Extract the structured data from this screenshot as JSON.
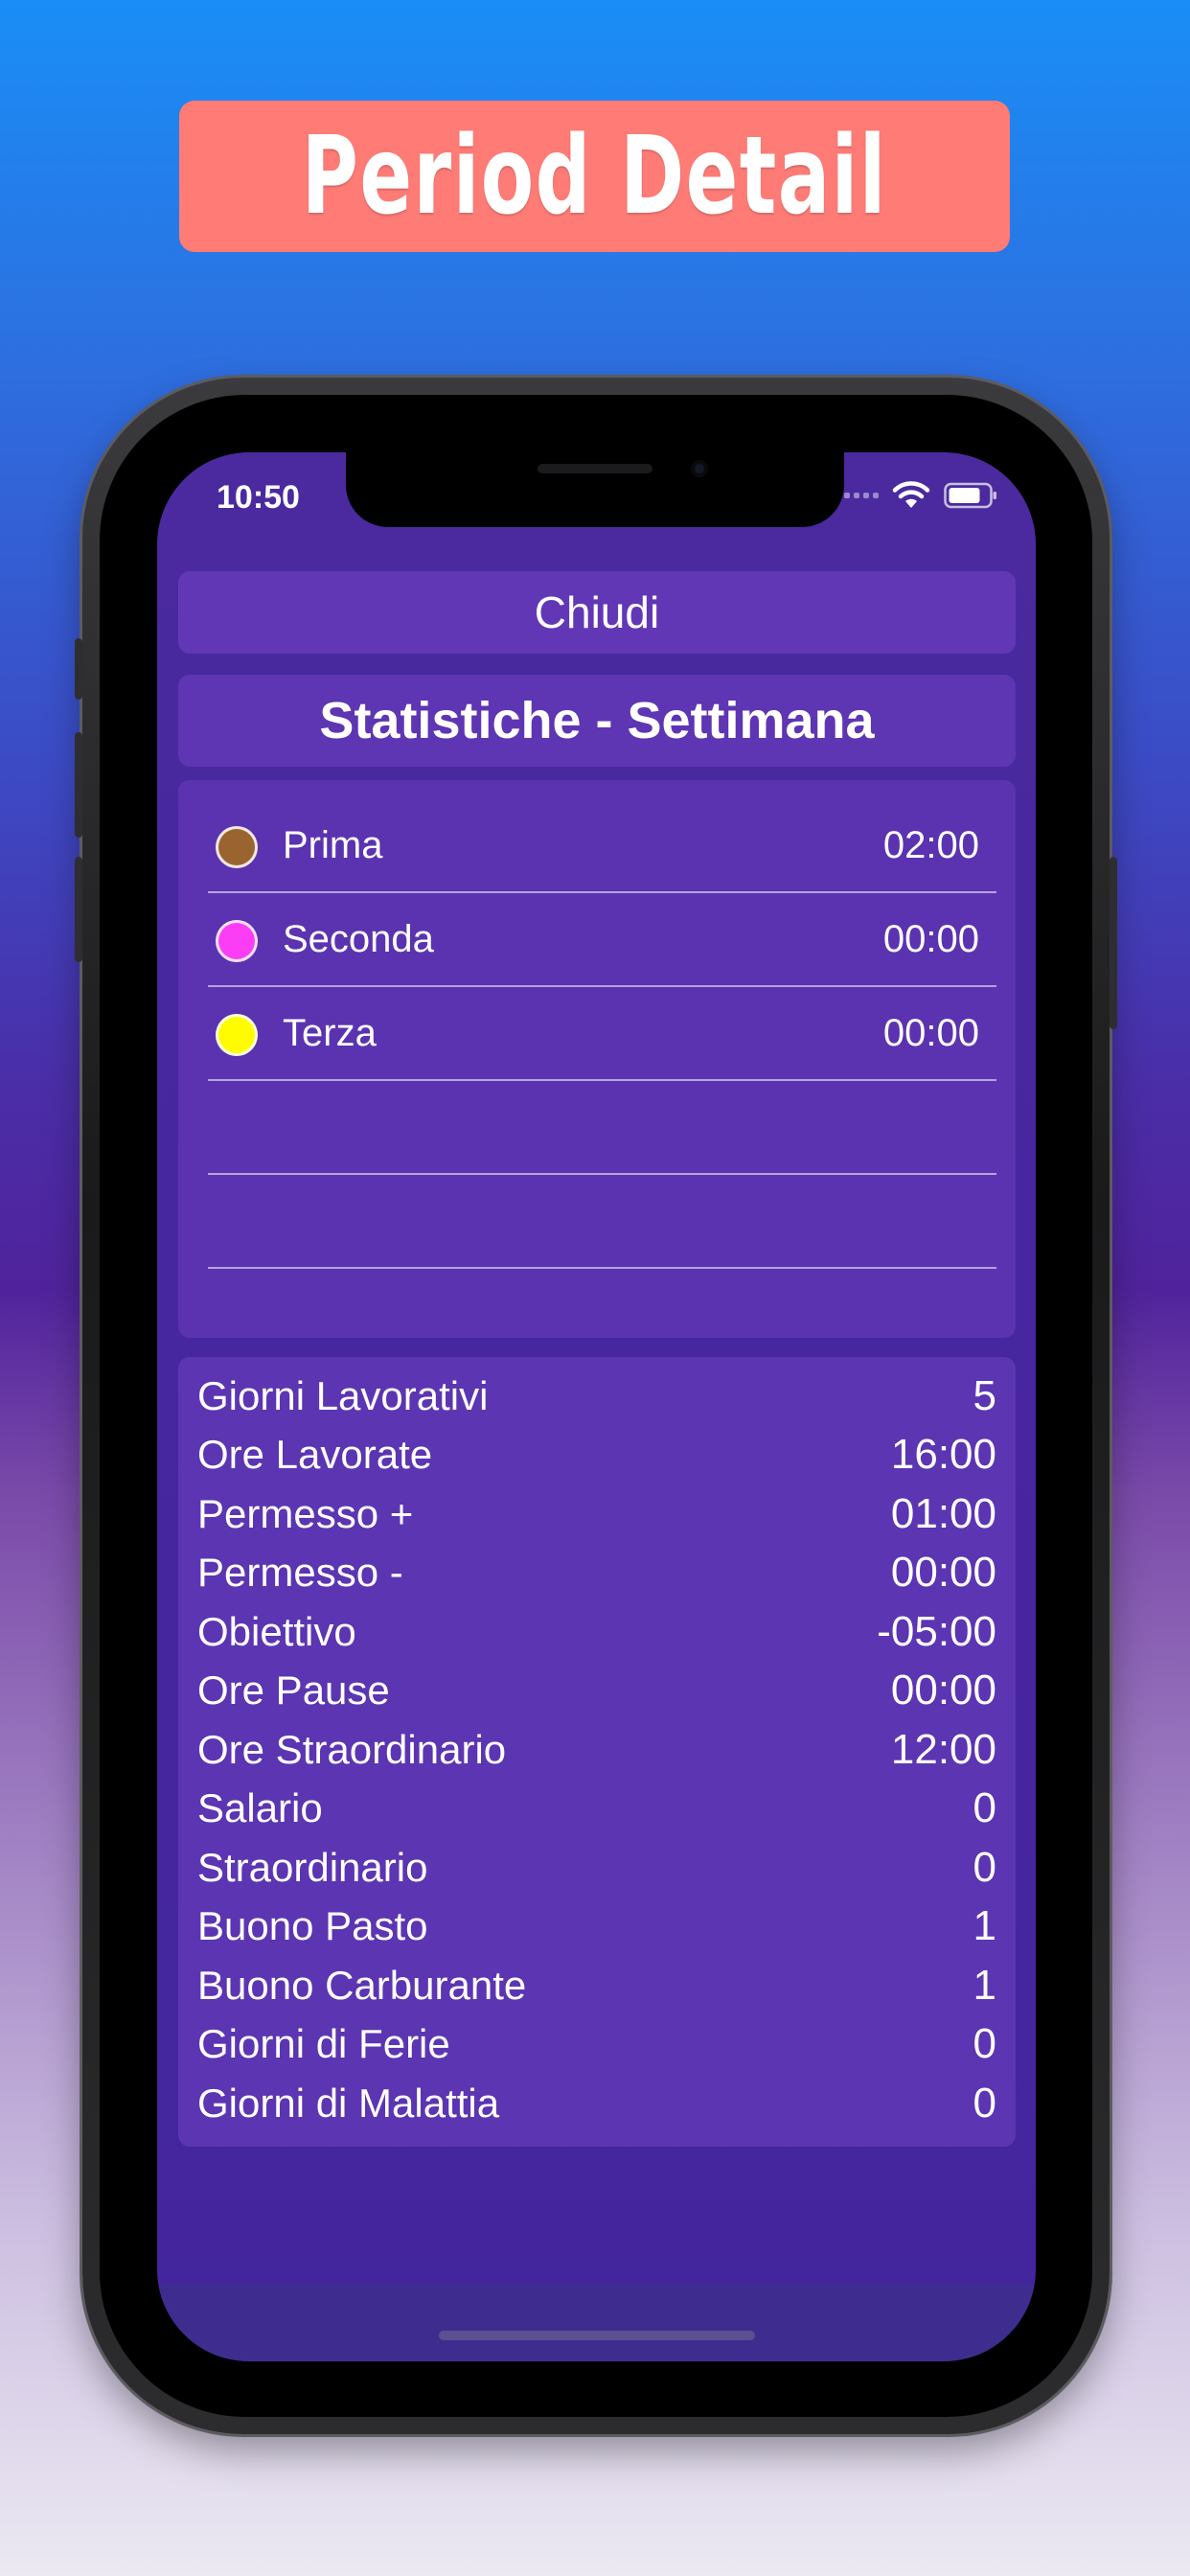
{
  "banner": {
    "title": "Period Detail",
    "color": "#fe7b76"
  },
  "status_bar": {
    "time": "10:50",
    "icons": [
      "signal-icon",
      "wifi-icon",
      "battery-icon"
    ]
  },
  "close_button": {
    "label": "Chiudi"
  },
  "title": "Statistiche - Settimana",
  "legend": {
    "items": [
      {
        "name": "Prima",
        "value": "02:00",
        "color": "#9a6431"
      },
      {
        "name": "Seconda",
        "value": "00:00",
        "color": "#fb3ef5"
      },
      {
        "name": "Terza",
        "value": "00:00",
        "color": "#fffb00"
      }
    ]
  },
  "stats": {
    "rows": [
      {
        "label": "Giorni Lavorativi",
        "value": "5"
      },
      {
        "label": "Ore Lavorate",
        "value": "16:00"
      },
      {
        "label": "Permesso +",
        "value": "01:00"
      },
      {
        "label": "Permesso -",
        "value": "00:00"
      },
      {
        "label": "Obiettivo",
        "value": "-05:00"
      },
      {
        "label": "Ore Pause",
        "value": "00:00"
      },
      {
        "label": "Ore Straordinario",
        "value": "12:00"
      },
      {
        "label": "Salario",
        "value": "0"
      },
      {
        "label": "Straordinario",
        "value": "0"
      },
      {
        "label": "Buono Pasto",
        "value": "1"
      },
      {
        "label": "Buono Carburante",
        "value": "1"
      },
      {
        "label": "Giorni di Ferie",
        "value": "0"
      },
      {
        "label": "Giorni di Malattia",
        "value": "0"
      }
    ]
  },
  "colors": {
    "screen_background": "#4a2a9e",
    "card": "#6237b6"
  }
}
